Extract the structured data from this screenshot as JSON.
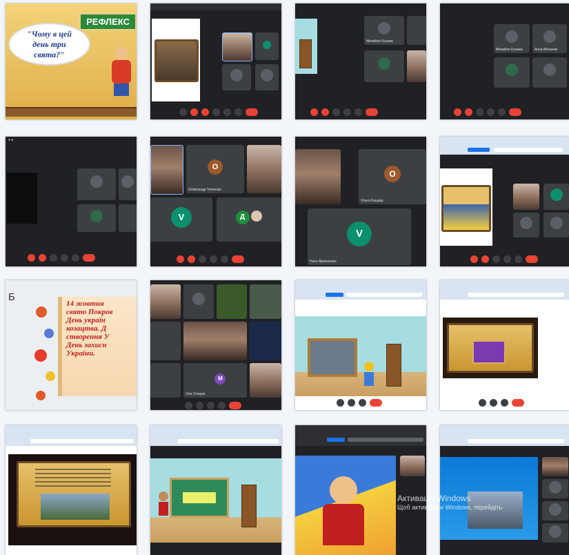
{
  "collage": {
    "slide_title": "РЕФЛЕКС",
    "slide_question": "\"Чому в цей день три свята?\"",
    "letter_b": "Б",
    "holiday_text": [
      "14 жовтня",
      "свято Покров",
      "День україн",
      "козацтва. Д",
      "створення У",
      "День захисн",
      "України."
    ],
    "tile_name_1": "Михайло Кузьма",
    "tile_name_2": "Анна Мельник",
    "tile_name_3": "Михайло Кузьма",
    "tile_name_4": "Ната Ярмоленко",
    "tile_name_5": "Олександр Ткаченко",
    "tile_name_6": "Ольга Бондар",
    "tile_name_7": "Оля Стецюк",
    "avatar_letter_o": "O",
    "avatar_letter_v": "V",
    "avatar_letter_d": "Д",
    "avatar_letter_m": "M",
    "watermark_line1": "Активація Windows",
    "watermark_line2": "Щоб активувати Windows, перейдіть"
  },
  "colors": {
    "meet_bg": "#202124",
    "tile_bg": "#3c4043",
    "end_call": "#ea4335",
    "avatar_orange": "#9c5a2e",
    "avatar_teal": "#0b8f6c",
    "avatar_green": "#1e8e3e",
    "avatar_purple": "#7b4ab8"
  }
}
